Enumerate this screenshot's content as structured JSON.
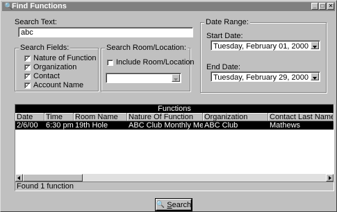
{
  "window": {
    "title": "Find Functions",
    "icon": "binoculars-icon",
    "controls": [
      "minimize-icon",
      "maximize-icon",
      "close-icon"
    ]
  },
  "search_text": {
    "label": "Search Text:",
    "value": "abc"
  },
  "search_fields": {
    "legend": "Search Fields:",
    "items": [
      {
        "label": "Nature of Function",
        "checked": true
      },
      {
        "label": "Organization",
        "checked": true
      },
      {
        "label": "Contact",
        "checked": true
      },
      {
        "label": "Account Name",
        "checked": true
      }
    ]
  },
  "room_location": {
    "legend": "Search Room/Location:",
    "include_label": "Include Room/Location",
    "include_checked": false,
    "select_value": ""
  },
  "date_range": {
    "legend": "Date Range:",
    "start_label": "Start Date:",
    "start_value": "Tuesday, February 01, 2000",
    "end_label": "End Date:",
    "end_value": "Tuesday, February 29, 2000"
  },
  "results": {
    "title": "Functions",
    "columns": [
      "Date",
      "Time",
      "Room Name",
      "Nature Of Function",
      "Organization",
      "Contact Last Name"
    ],
    "rows": [
      [
        "2/6/00",
        "6:30 pm",
        "19th Hole",
        "ABC Club Monthly Meeting",
        "ABC Club",
        "Mathews"
      ]
    ],
    "status": "Found 1 function"
  },
  "search_button": {
    "label": "Search",
    "accelerator": "S",
    "rest": "earch",
    "icon": "binoculars-icon"
  }
}
